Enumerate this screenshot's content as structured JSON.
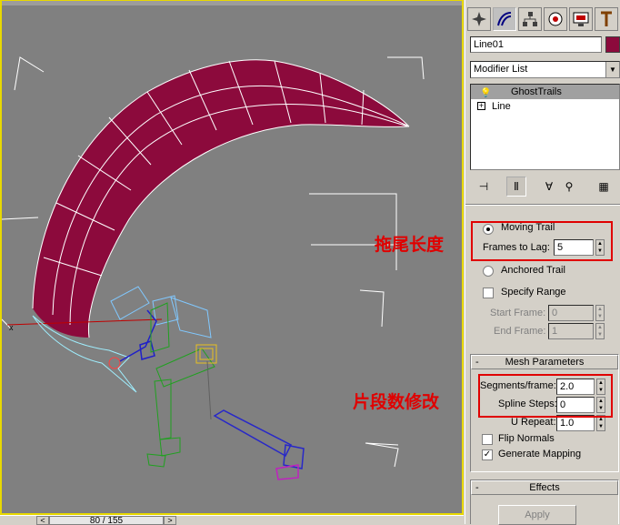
{
  "viewport": {
    "time_current": "80",
    "time_total": "155",
    "time_slider_label": "80 / 155"
  },
  "panel": {
    "object_name": "Line01",
    "object_color": "#8c0a3c",
    "modifier_list": "Modifier List",
    "stack": [
      {
        "label": "GhostTrails",
        "icon": "lightbulb-icon"
      },
      {
        "label": "Line",
        "icon": "plus-icon"
      }
    ],
    "tabs": [
      "create-icon",
      "modify-icon",
      "hierarchy-icon",
      "motion-icon",
      "display-icon",
      "utilities-icon"
    ],
    "trail": {
      "moving_trail_label": "Moving Trail",
      "frames_to_lag_label": "Frames to Lag:",
      "frames_to_lag_value": "5",
      "anchored_trail_label": "Anchored Trail",
      "specify_range_label": "Specify Range",
      "start_frame_label": "Start Frame:",
      "start_frame_value": "0",
      "end_frame_label": "End Frame:",
      "end_frame_value": "1"
    },
    "mesh": {
      "title": "Mesh Parameters",
      "segments_label": "Segments/frame:",
      "segments_value": "2.0",
      "spline_steps_label": "Spline Steps:",
      "spline_steps_value": "0",
      "u_repeat_label": "U Repeat:",
      "u_repeat_value": "1.0",
      "flip_normals_label": "Flip Normals",
      "generate_mapping_label": "Generate Mapping"
    },
    "effects": {
      "title": "Effects",
      "apply_label": "Apply"
    }
  },
  "annotations": {
    "trail_length": "拖尾长度",
    "segment_edit": "片段数修改"
  },
  "colors": {
    "viewport_border": "#e8d800",
    "ribbon": "#8c0a3c",
    "highlight": "#e00000"
  }
}
